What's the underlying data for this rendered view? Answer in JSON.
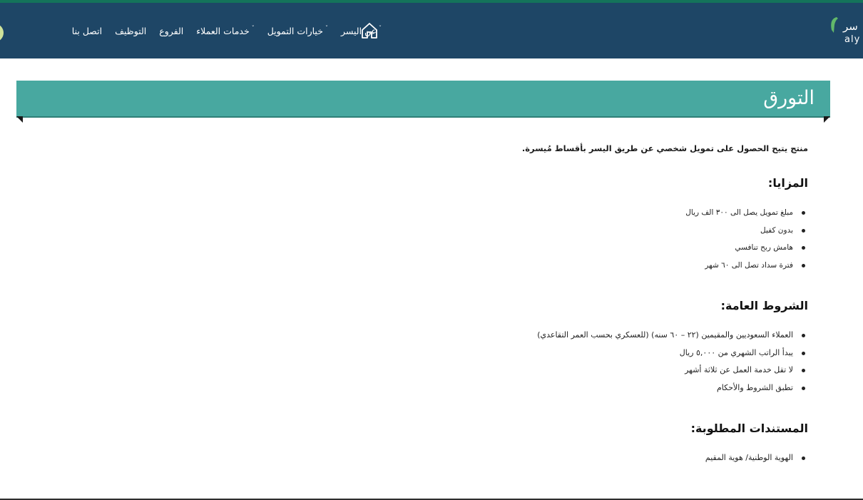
{
  "nav": {
    "items": [
      {
        "label": "عن اليسر",
        "has_caret": true
      },
      {
        "label": "خيارات التمويل",
        "has_caret": true
      },
      {
        "label": "خدمات العملاء",
        "has_caret": true
      },
      {
        "label": "الفروع",
        "has_caret": false
      },
      {
        "label": "التوظيف",
        "has_caret": false
      },
      {
        "label": "اتصل بنا",
        "has_caret": false
      }
    ],
    "caret": "ˇ"
  },
  "logo": {
    "ar": "سر",
    "en": "aly"
  },
  "page": {
    "title": "التورق",
    "intro": "منتج يتيح الحصول على تمويل شخصي عن طريق اليسر بأقساط مُيسرة."
  },
  "sections": [
    {
      "heading": "المزايا:",
      "items": [
        "مبلغ تمويل يصل الى ٣٠٠ الف ريال",
        "بدون كفيل",
        "هامش ربح تنافسي",
        "فترة سداد تصل الى ٦٠ شهر"
      ]
    },
    {
      "heading": "الشروط العامة:",
      "items": [
        "العملاء السعوديين والمقيمين (٢٢ – ٦٠ سنه) (للعسكري بحسب العمر التقاعدي)",
        "يبدأ الراتب الشهري من ٥,٠٠٠ ريال",
        "لا تقل خدمة العمل عن ثلاثة أشهر",
        "تطبق الشروط والأحكام"
      ]
    },
    {
      "heading": "المستندات المطلوبة:",
      "items": [
        "الهوية الوطنية/ هوية المقيم"
      ]
    }
  ],
  "colors": {
    "header_bg": "#1e4666",
    "banner_bg": "#48a8a0",
    "accent_green": "#14735a"
  }
}
